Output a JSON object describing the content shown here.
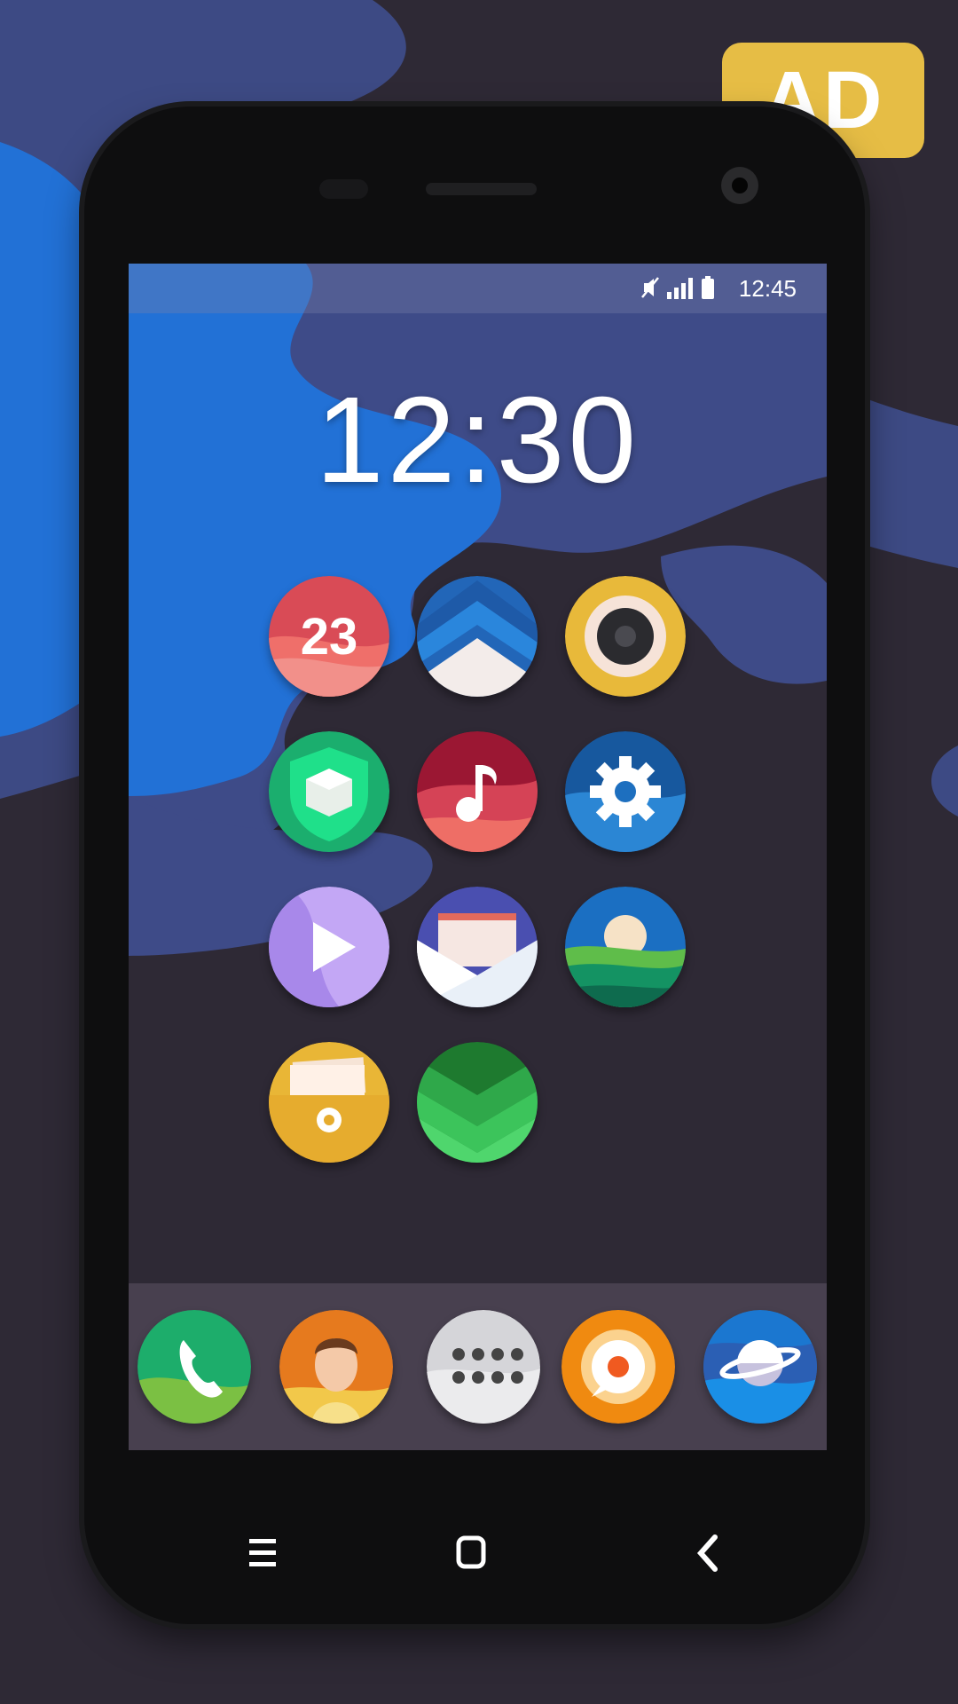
{
  "ad_badge": "AD",
  "status_bar": {
    "time": "12:45",
    "icons": [
      "mute-icon",
      "signal-icon",
      "battery-icon"
    ]
  },
  "clock": "12:30",
  "home_icons": [
    {
      "name": "calendar",
      "label": "23",
      "color": "#d94b56"
    },
    {
      "name": "launcher-arrow",
      "color": "#2a7dd1"
    },
    {
      "name": "camera",
      "color": "#e8b93a"
    },
    {
      "name": "security-shield",
      "color": "#1dbd7b"
    },
    {
      "name": "music",
      "color": "#c2334a"
    },
    {
      "name": "settings",
      "color": "#1b7ac7"
    },
    {
      "name": "video-player",
      "color": "#b59cf0"
    },
    {
      "name": "email",
      "color": "#4a55b0"
    },
    {
      "name": "gallery",
      "color": "#1b6fc2"
    },
    {
      "name": "file-manager",
      "color": "#e9b636"
    },
    {
      "name": "store-chevrons",
      "color": "#2fa84a"
    }
  ],
  "dock_icons": [
    {
      "name": "phone",
      "color": "#1dad6b"
    },
    {
      "name": "contacts",
      "color": "#e67a1e"
    },
    {
      "name": "app-drawer",
      "color": "#cfcfd3"
    },
    {
      "name": "messages",
      "color": "#f08a10"
    },
    {
      "name": "browser",
      "color": "#1b77d0"
    }
  ],
  "nav_buttons": [
    "menu-icon",
    "home-icon",
    "back-icon"
  ]
}
